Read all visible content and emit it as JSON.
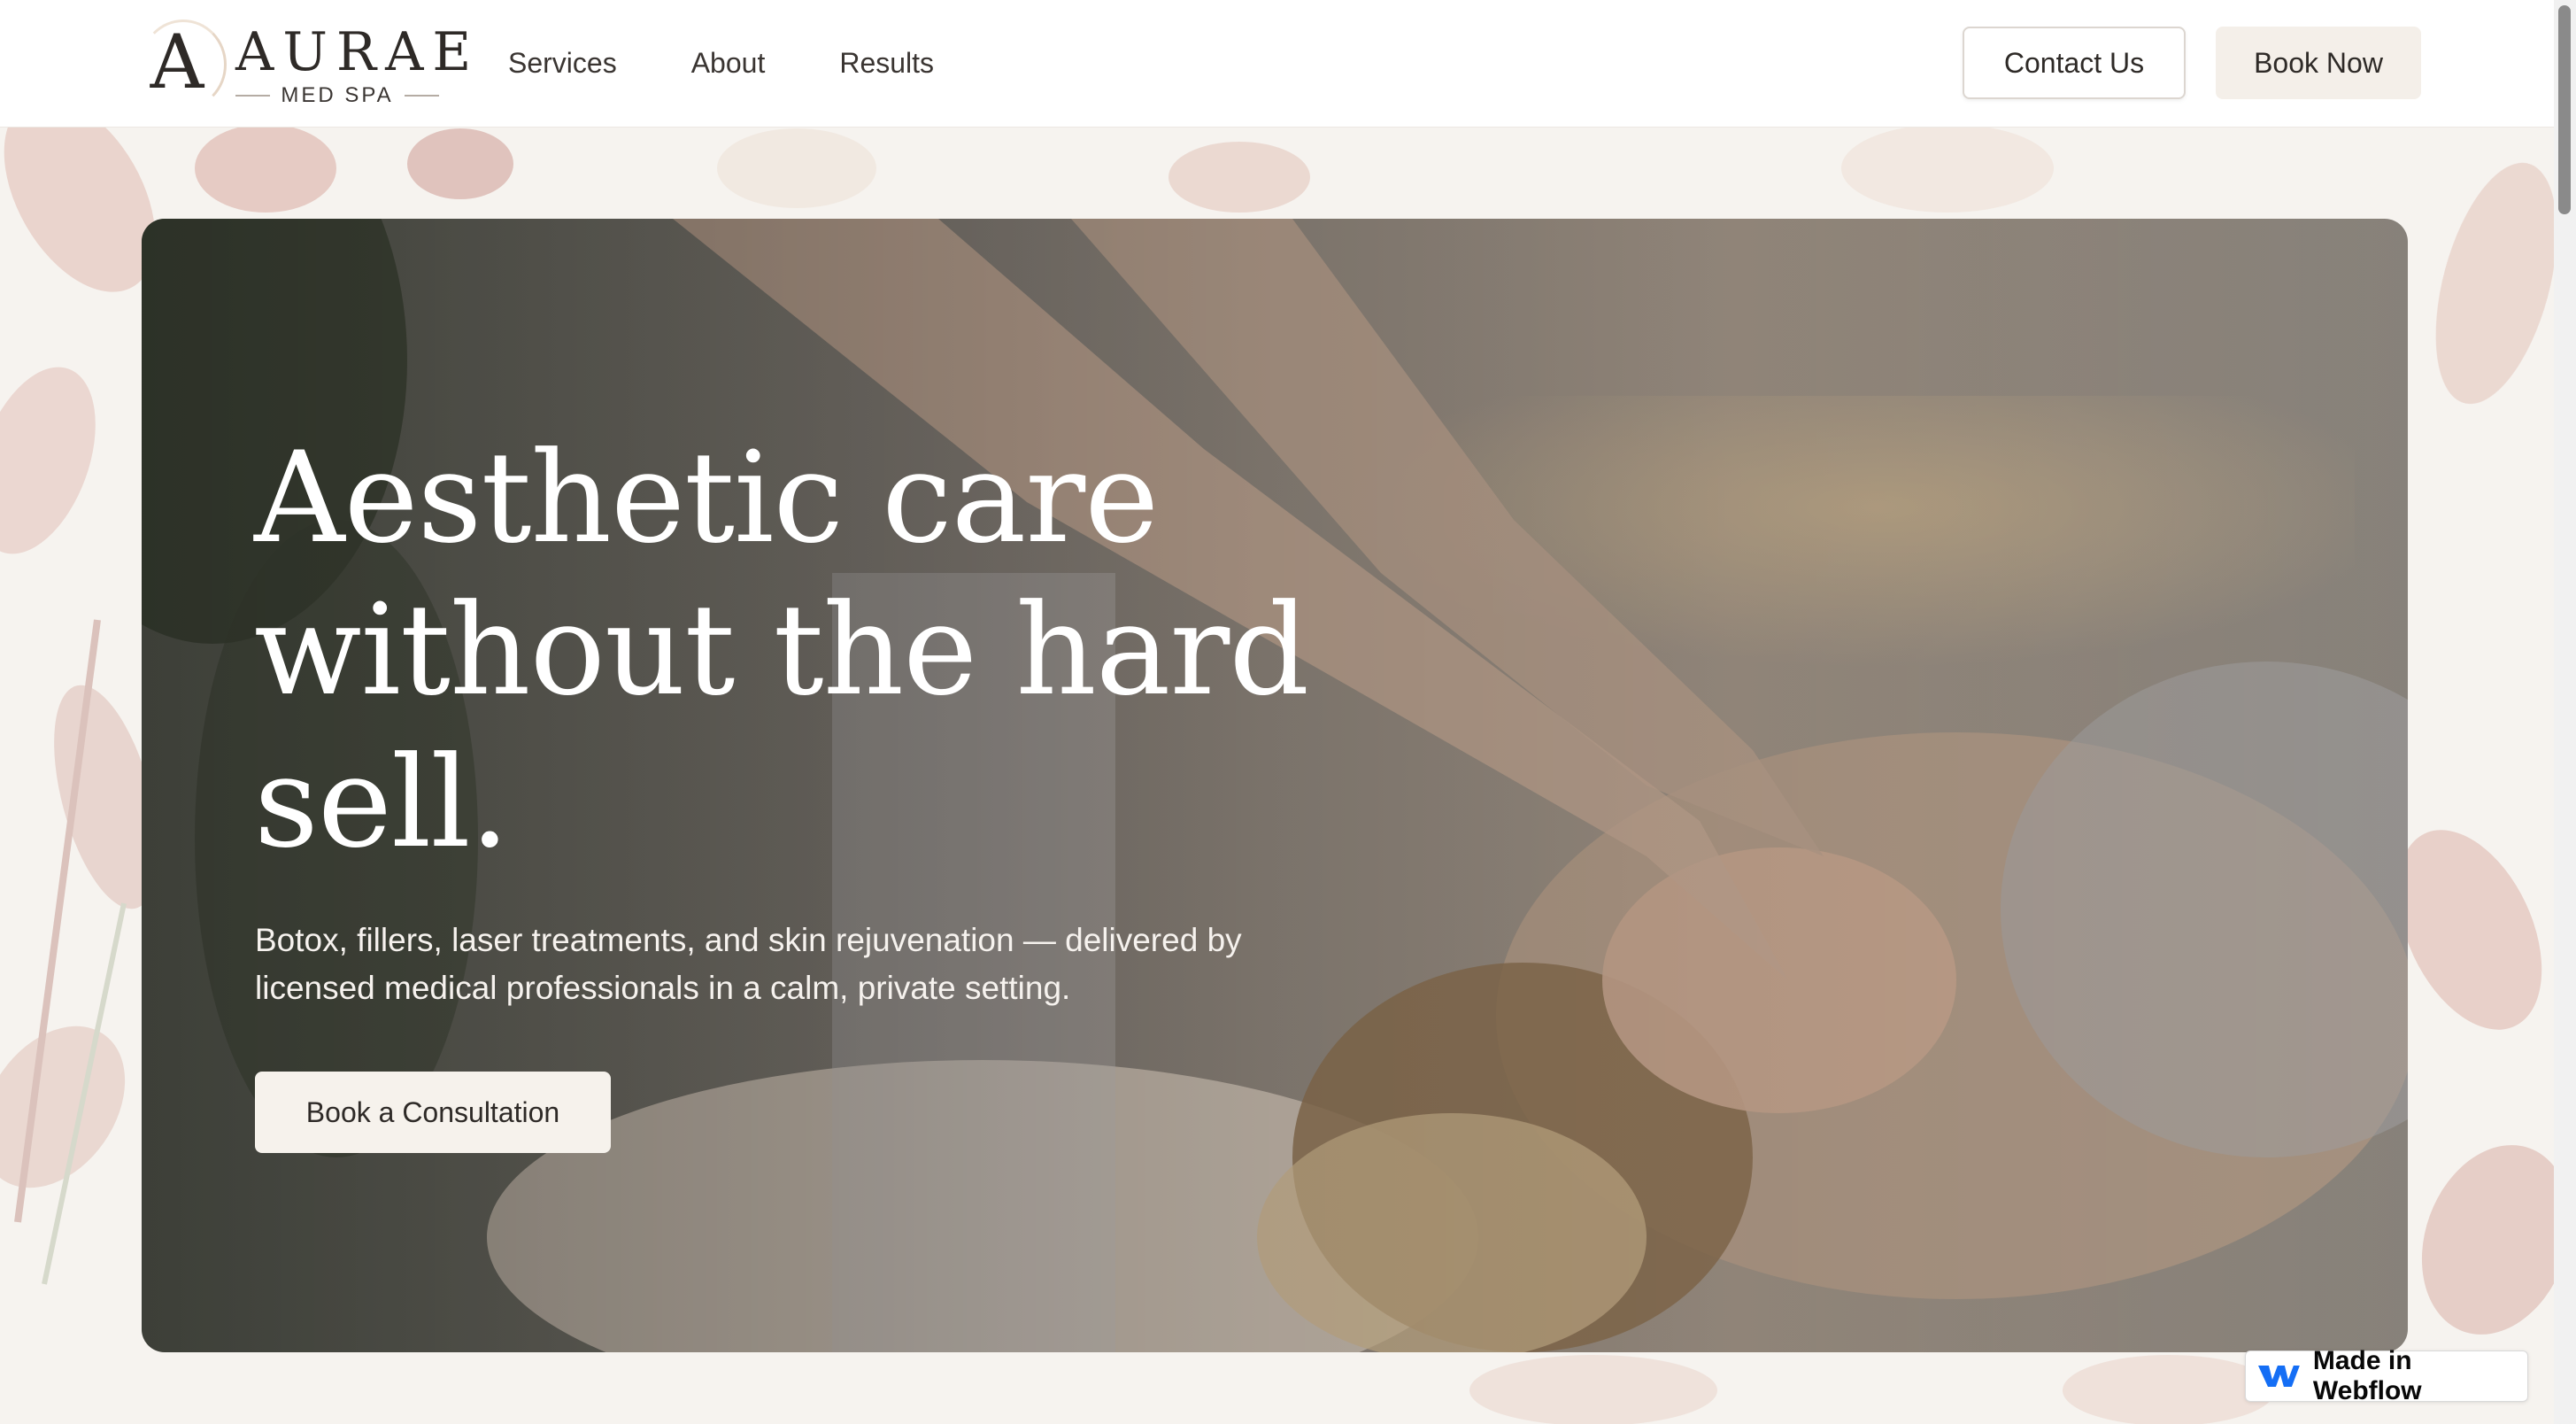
{
  "brand": {
    "logo_letter": "A",
    "name": "AURAE",
    "subtitle": "MED SPA"
  },
  "nav": {
    "items": [
      {
        "label": "Services"
      },
      {
        "label": "About"
      },
      {
        "label": "Results"
      }
    ]
  },
  "header_actions": {
    "contact_label": "Contact Us",
    "book_label": "Book Now"
  },
  "hero": {
    "title": "Aesthetic care without the hard sell.",
    "subtitle": "Botox, fillers, laser treatments, and skin rejuvenation — delivered by licensed medical professionals in a calm, private setting.",
    "cta_label": "Book a Consultation"
  },
  "badge": {
    "label": "Made in Webflow",
    "icon": "webflow-logo-icon"
  },
  "colors": {
    "page_bg": "#f6f3ef",
    "text_dark": "#2e2a27",
    "cta_bg": "#f6f2ec",
    "webflow_blue": "#146ef5"
  }
}
